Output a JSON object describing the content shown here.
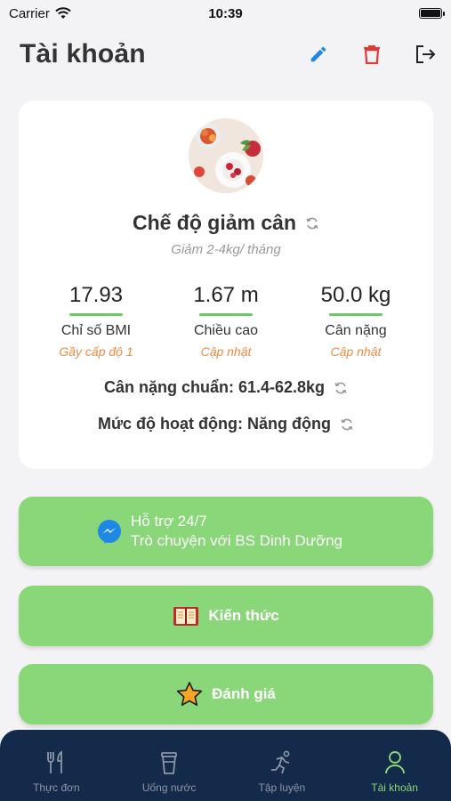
{
  "status": {
    "carrier": "Carrier",
    "time": "10:39"
  },
  "header": {
    "title": "Tài khoản"
  },
  "profile": {
    "diet_title": "Chế độ giảm cân",
    "diet_subtitle": "Giảm 2-4kg/ tháng",
    "stats": [
      {
        "value": "17.93",
        "label": "Chỉ số BMI",
        "action": "Gầy cấp độ 1"
      },
      {
        "value": "1.67 m",
        "label": "Chiều cao",
        "action": "Cập nhật"
      },
      {
        "value": "50.0 kg",
        "label": "Cân nặng",
        "action": "Cập nhật"
      }
    ],
    "ideal_weight": "Cân nặng chuẩn: 61.4-62.8kg",
    "activity_level": "Mức độ hoạt động: Năng động"
  },
  "buttons": {
    "support_line1": "Hỗ trợ 24/7",
    "support_line2": "Trò chuyện với BS Dinh Dưỡng",
    "knowledge": "Kiến thức",
    "rate": "Đánh giá"
  },
  "tabs": [
    {
      "label": "Thực đơn",
      "icon": "utensils-icon",
      "active": false
    },
    {
      "label": "Uống nước",
      "icon": "cup-icon",
      "active": false
    },
    {
      "label": "Tập luyện",
      "icon": "runner-icon",
      "active": false
    },
    {
      "label": "Tài khoản",
      "icon": "person-icon",
      "active": true
    }
  ],
  "colors": {
    "accent_green": "#8ad77a",
    "edit_blue": "#1e88e5",
    "delete_red": "#e53935",
    "stat_action_orange": "#f08a42",
    "tabbar_navy": "#132a4b"
  }
}
